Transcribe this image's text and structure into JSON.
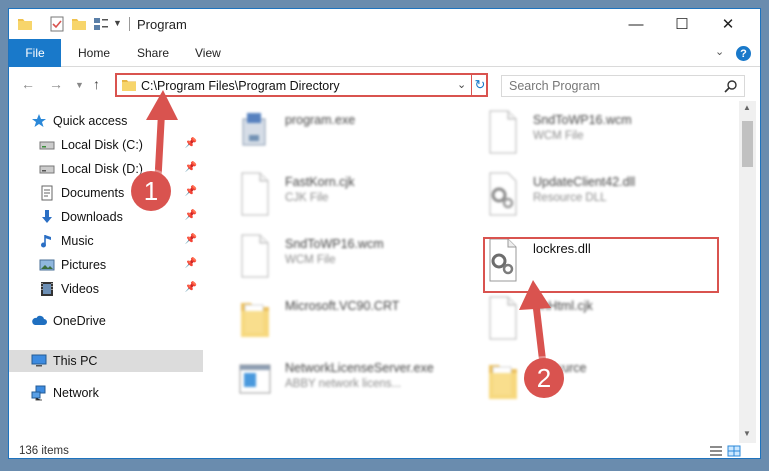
{
  "window": {
    "title": "Program",
    "controls": {
      "minimize": "—",
      "maximize": "☐",
      "close": "✕"
    }
  },
  "ribbon": {
    "file": "File",
    "tabs": [
      "Home",
      "Share",
      "View"
    ],
    "help": "?"
  },
  "address": {
    "path": "C:\\Program Files\\Program Directory",
    "search_placeholder": "Search Program"
  },
  "sidebar": {
    "items": [
      {
        "label": "Quick access",
        "icon": "star-icon",
        "pinned": false
      },
      {
        "label": "Local Disk (C:)",
        "icon": "drive-icon",
        "pinned": true
      },
      {
        "label": "Local Disk (D:)",
        "icon": "drive-icon",
        "pinned": true
      },
      {
        "label": "Documents",
        "icon": "documents-icon",
        "pinned": true
      },
      {
        "label": "Downloads",
        "icon": "downloads-icon",
        "pinned": true
      },
      {
        "label": "Music",
        "icon": "music-icon",
        "pinned": true
      },
      {
        "label": "Pictures",
        "icon": "pictures-icon",
        "pinned": true
      },
      {
        "label": "Videos",
        "icon": "videos-icon",
        "pinned": true
      },
      {
        "label": "OneDrive",
        "icon": "cloud-icon",
        "pinned": false
      },
      {
        "label": "This PC",
        "icon": "computer-icon",
        "pinned": false,
        "selected": true
      },
      {
        "label": "Network",
        "icon": "network-icon",
        "pinned": false
      }
    ]
  },
  "files": [
    {
      "name": "program.exe",
      "type": "",
      "icon": "exe-installer-icon"
    },
    {
      "name": "SndToWP16.wcm",
      "type": "WCM File",
      "icon": "blank-file-icon"
    },
    {
      "name": "FastKorn.cjk",
      "type": "CJK File",
      "icon": "blank-file-icon"
    },
    {
      "name": "UpdateClient42.dll",
      "type": "Resource DLL",
      "icon": "dll-gear-icon"
    },
    {
      "name": "SndToWP16.wcm",
      "type": "WCM File",
      "icon": "blank-file-icon"
    },
    {
      "name": "lockres.dll",
      "type": "",
      "icon": "dll-gear-icon"
    },
    {
      "name": "Microsoft.VC90.CRT",
      "type": "",
      "icon": "folder-icon"
    },
    {
      "name": "SnHtml.cjk",
      "type": "",
      "icon": "blank-file-icon"
    },
    {
      "name": "NetworkLicenseServer.exe",
      "type": "ABBY network licens...",
      "icon": "app-window-icon"
    },
    {
      "name": "Resource",
      "type": "",
      "icon": "folder-icon"
    }
  ],
  "status": {
    "count": "136 items"
  },
  "annotations": {
    "step1": "1",
    "step2": "2"
  },
  "colors": {
    "accent": "#1979ca",
    "annotation": "#d9534f",
    "selected": "#dcdcdc"
  }
}
